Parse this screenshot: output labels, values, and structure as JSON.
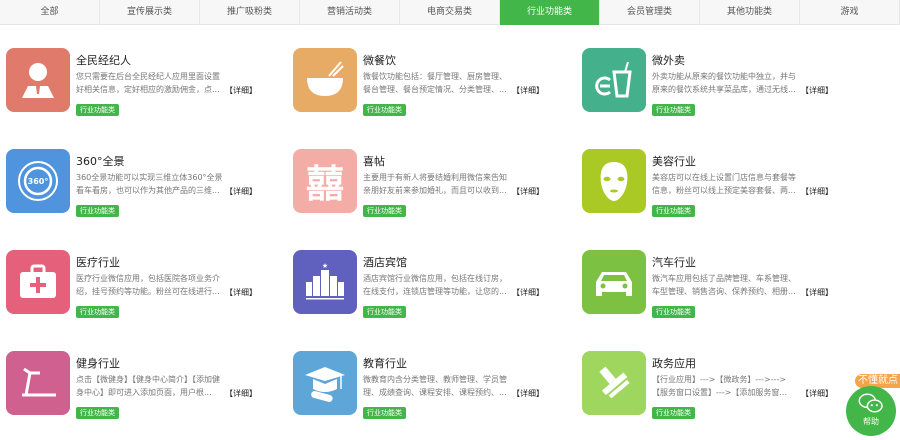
{
  "tabs": [
    "全部",
    "宣传展示类",
    "推广吸粉类",
    "营销活动类",
    "电商交易类",
    "行业功能类",
    "会员管理类",
    "其他功能类",
    "游戏"
  ],
  "active_tab": 5,
  "detail_label": "【详细】",
  "cards": [
    {
      "title": "全民经纪人",
      "desc": "您只需要在后台全民经纪人应用里面设置好相关信息，定好相应的激励佣金，点...",
      "tag": "行业功能类",
      "icon": "broker-icon",
      "color": "#e07a6a"
    },
    {
      "title": "微餐饮",
      "desc": "微餐饮功能包括：餐厅管理、厨房管理、餐台管理、餐台预定情况、分类管理、...",
      "tag": "行业功能类",
      "icon": "bowl-icon",
      "color": "#e8ab66"
    },
    {
      "title": "微外卖",
      "desc": "外卖功能从原来的餐饮功能中独立，并与原来的餐饮系统共享菜品库，通过无线...",
      "tag": "行业功能类",
      "icon": "takeaway-icon",
      "color": "#45b08c"
    },
    {
      "title": "360°全景",
      "desc": "360全景功能可以实现三维立体360°全景看车看房，也可以作为其他产品的三维...",
      "tag": "行业功能类",
      "icon": "panorama-360-icon",
      "color": "#4f94dc"
    },
    {
      "title": "喜帖",
      "desc": "主要用于有新人将要结婚利用微信来告知亲朋好友前来参加婚礼，而且可以收到...",
      "tag": "行业功能类",
      "icon": "double-happiness-icon",
      "color": "#f4aca6"
    },
    {
      "title": "美容行业",
      "desc": "美容店可以在线上设置门店信息与套餐等信息，粉丝可以线上预定美容套餐、两...",
      "tag": "行业功能类",
      "icon": "face-mask-icon",
      "color": "#aac925"
    },
    {
      "title": "医疗行业",
      "desc": "医疗行业微信应用，包括医院各项业务介绍，挂号预约等功能。粉丝可在线进行...",
      "tag": "行业功能类",
      "icon": "medical-kit-icon",
      "color": "#e5607a"
    },
    {
      "title": "酒店宾馆",
      "desc": "酒店宾馆行业微信应用，包括在线订房，在线支付，连锁店管理等功能，让您的...",
      "tag": "行业功能类",
      "icon": "hotel-icon",
      "color": "#6060bf"
    },
    {
      "title": "汽车行业",
      "desc": "微汽车应用包括了品牌管理、车系管理、车型管理、销售咨询、保养预约、相册...",
      "tag": "行业功能类",
      "icon": "car-icon",
      "color": "#7dc142"
    },
    {
      "title": "健身行业",
      "desc": "点击【微健身】【健身中心简介】【添加健身中心】即可进入添加页面，用户根...",
      "tag": "行业功能类",
      "icon": "treadmill-icon",
      "color": "#d06090"
    },
    {
      "title": "教育行业",
      "desc": "微教育内含分类管理、教师管理、学员管理、成绩查询、课程安排、课程预约、...",
      "tag": "行业功能类",
      "icon": "graduation-cap-icon",
      "color": "#5ea5d8"
    },
    {
      "title": "政务应用",
      "desc": "【行业应用】--->【微政务】--->--->【服务窗口设置】--->【添加服务窗...",
      "tag": "行业功能类",
      "icon": "stamp-icon",
      "color": "#9ed65e"
    }
  ],
  "help": {
    "badge": "不懂就点",
    "label": "帮助",
    "icon": "wechat-icon",
    "color": "#43b649"
  }
}
